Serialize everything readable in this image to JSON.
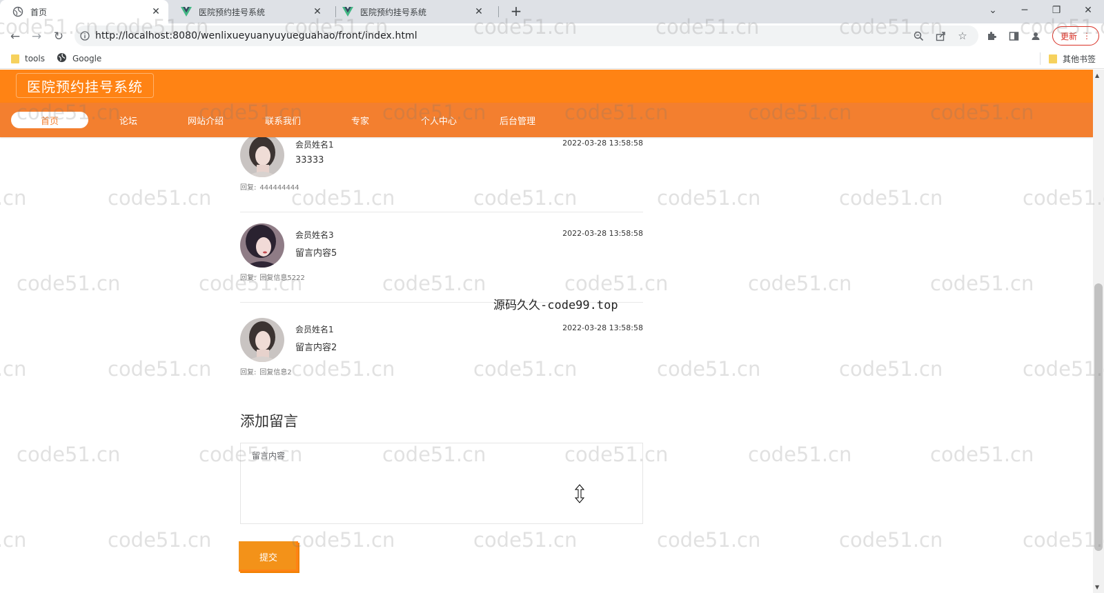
{
  "browser": {
    "tabs": [
      {
        "title": "首页",
        "active": true
      },
      {
        "title": "医院预约挂号系统",
        "active": false
      },
      {
        "title": "医院预约挂号系统",
        "active": false
      }
    ],
    "address": "http://localhost:8080/wenlixueyuanyuyueguahao/front/index.html",
    "update_label": "更新",
    "bookmarks": [
      {
        "label": "tools",
        "icon": "folder-icon"
      },
      {
        "label": "Google",
        "icon": "globe-icon"
      }
    ],
    "other_bookmarks": "其他书签"
  },
  "site": {
    "logo": "医院预约挂号系统",
    "nav": [
      "首页",
      "论坛",
      "网站介绍",
      "联系我们",
      "专家",
      "个人中心",
      "后台管理"
    ],
    "active_nav": 0
  },
  "messages": [
    {
      "name": "会员姓名1",
      "time": "2022-03-28 13:58:58",
      "content": "33333",
      "reply_label": "回复:",
      "reply": "444444444"
    },
    {
      "name": "会员姓名3",
      "time": "2022-03-28 13:58:58",
      "content": "留言内容5",
      "reply_label": "回复:",
      "reply": "回复信息5222"
    },
    {
      "name": "会员姓名1",
      "time": "2022-03-28 13:58:58",
      "content": "留言内容2",
      "reply_label": "回复:",
      "reply": "回复信息2"
    }
  ],
  "form": {
    "title": "添加留言",
    "placeholder": "留言内容",
    "submit": "提交"
  },
  "watermark": "code51.cn",
  "watermark2": "源码久久-code99.top",
  "colors": {
    "header": "#ff8314",
    "nav": "#f37f2f",
    "button": "#f39219"
  }
}
